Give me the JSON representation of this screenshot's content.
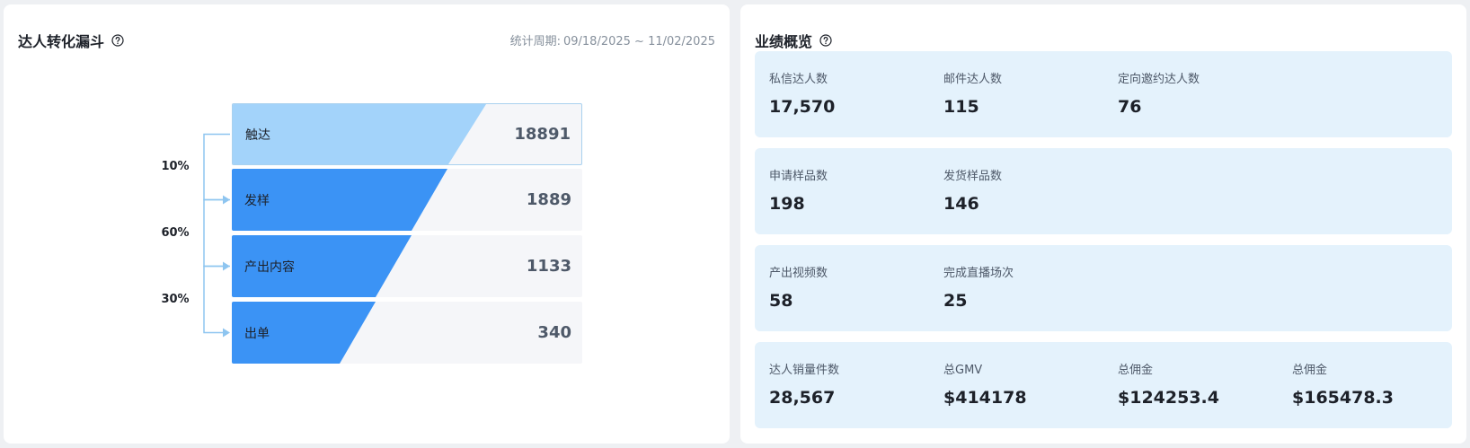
{
  "funnel_card": {
    "title": "达人转化漏斗",
    "period_label": "统计周期:",
    "period_value": "09/18/2025 ~ 11/02/2025",
    "stages": [
      {
        "label": "触达",
        "value": "18891",
        "color": "#a3d3fa"
      },
      {
        "label": "发样",
        "value": "1889",
        "color": "#3b93f5"
      },
      {
        "label": "产出内容",
        "value": "1133",
        "color": "#3b93f5"
      },
      {
        "label": "出单",
        "value": "340",
        "color": "#3b93f5"
      }
    ],
    "conversion_rates": [
      "10%",
      "60%",
      "30%"
    ],
    "connector_color": "#8ec5f0"
  },
  "perf_card": {
    "title": "业绩概览",
    "panel_color": "#e4f2fc",
    "panels": [
      {
        "metrics": [
          {
            "label": "私信达人数",
            "value": "17,570"
          },
          {
            "label": "邮件达人数",
            "value": "115"
          },
          {
            "label": "定向邀约达人数",
            "value": "76"
          }
        ]
      },
      {
        "metrics": [
          {
            "label": "申请样品数",
            "value": "198"
          },
          {
            "label": "发货样品数",
            "value": "146"
          }
        ]
      },
      {
        "metrics": [
          {
            "label": "产出视频数",
            "value": "58"
          },
          {
            "label": "完成直播场次",
            "value": "25"
          }
        ]
      },
      {
        "metrics": [
          {
            "label": "达人销量件数",
            "value": "28,567"
          },
          {
            "label": "总GMV",
            "value": "$414178"
          },
          {
            "label": "总佣金",
            "value": "$124253.4"
          },
          {
            "label": "总佣金",
            "value": "$165478.3"
          }
        ]
      }
    ]
  }
}
